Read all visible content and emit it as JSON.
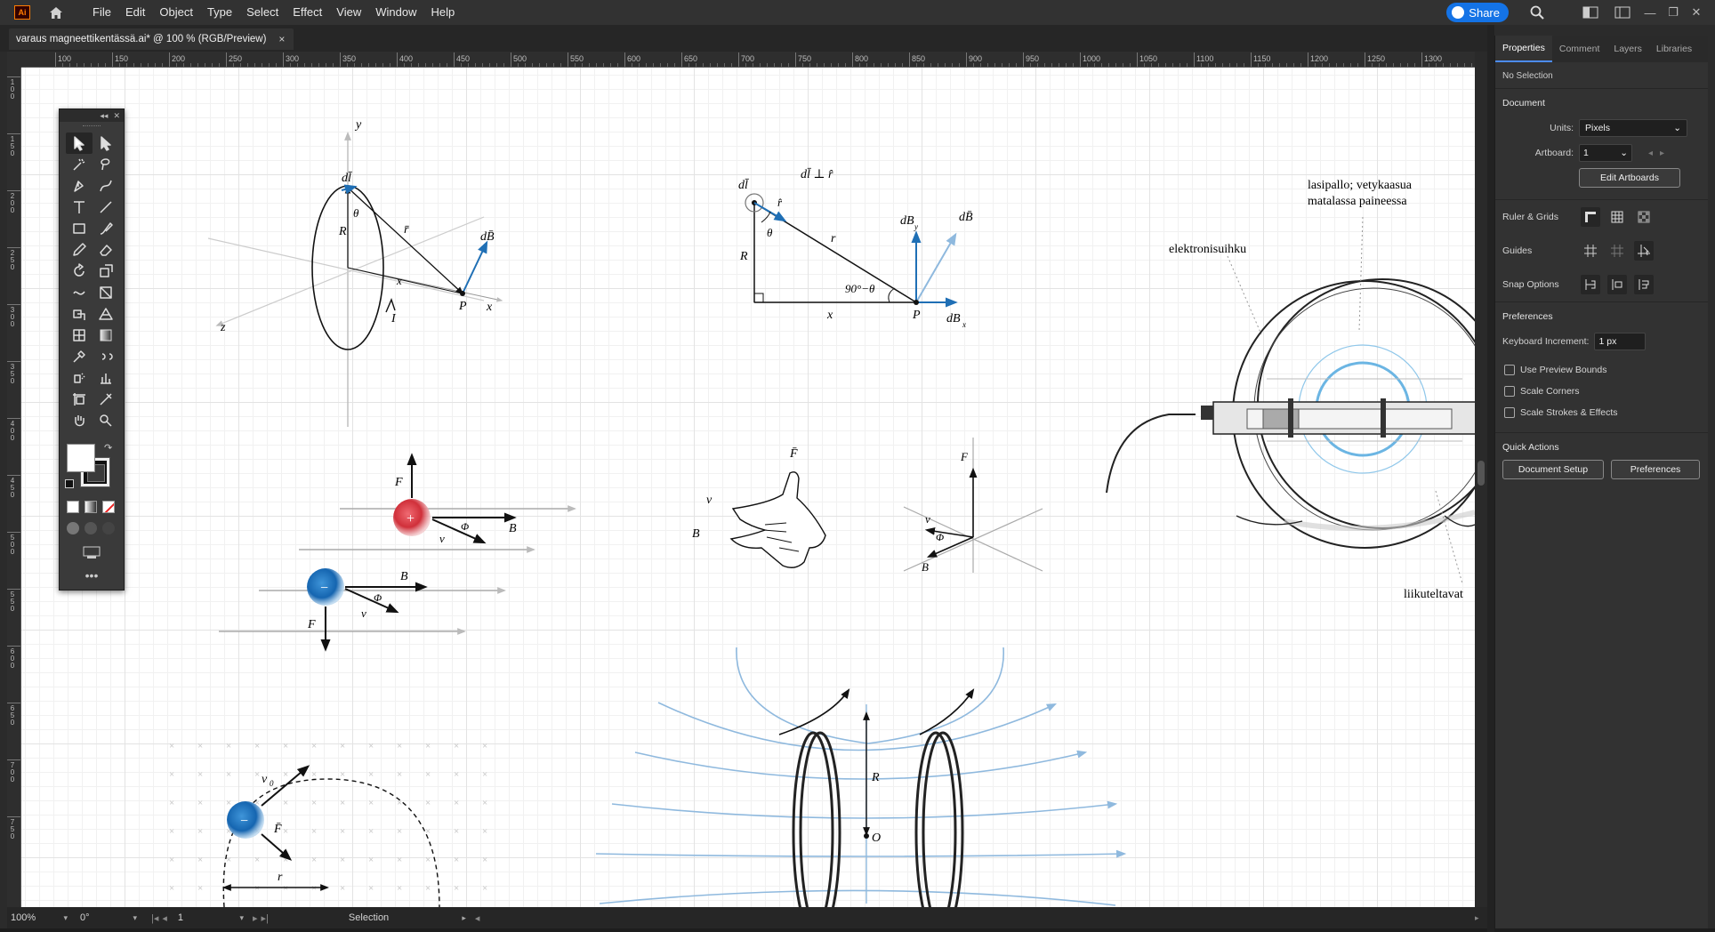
{
  "app": {
    "logo": "Ai",
    "menu": [
      "File",
      "Edit",
      "Object",
      "Type",
      "Select",
      "Effect",
      "View",
      "Window",
      "Help"
    ],
    "share_label": "Share"
  },
  "document": {
    "tab_title": "varaus magneettikentässä.ai* @ 100 % (RGB/Preview)",
    "tab_close": "×"
  },
  "ruler": {
    "top": [
      "100",
      "150",
      "200",
      "250",
      "300",
      "350",
      "400",
      "450",
      "500",
      "550",
      "600",
      "650",
      "700",
      "750",
      "800",
      "850",
      "900",
      "950",
      "1000",
      "1050",
      "1100",
      "1150",
      "1200",
      "1250",
      "1300"
    ],
    "left": [
      "100",
      "150",
      "200",
      "250",
      "300",
      "350",
      "400",
      "450",
      "500",
      "550",
      "600",
      "650",
      "700",
      "750"
    ]
  },
  "canvas_text": {
    "fig1": {
      "y": "y",
      "dl": "dl̄",
      "theta": "θ",
      "R": "R",
      "r": "r̄",
      "dB": "dB̄",
      "x_dist": "x",
      "P": "P",
      "x_axis": "x",
      "z_axis": "z",
      "I": "I"
    },
    "fig2": {
      "dl": "dl̄",
      "perp": "dl̄ ⊥ r̂",
      "rhat": "r̂",
      "theta": "θ",
      "r": "r",
      "R": "R",
      "angle": "90°−θ",
      "x": "x",
      "P": "P",
      "dBy": "dB",
      "dBy_sub": "y",
      "dB": "dB̄",
      "dBx": "dB",
      "dBx_sub": "x"
    },
    "fig3": {
      "glass": "lasipallo; vetykaasua",
      "glass2": "matalassa paineessa",
      "gun": "elektronisuihku",
      "coils": "liikuteltavat"
    },
    "fig4": {
      "F_top": "F",
      "plus": "+",
      "phi1": "Φ",
      "v1": "v",
      "B1": "B",
      "B2": "B",
      "phi2": "Φ",
      "minus": "−",
      "v2": "v",
      "F2": "F"
    },
    "fig5": {
      "F": "F̄",
      "v": "v",
      "B": "B",
      "F2": "F",
      "v2": "v",
      "phi": "Φ",
      "B2": "B"
    },
    "fig6": {
      "v0": "v",
      "v0_sub": "0",
      "minus": "−",
      "F": "F̄",
      "r": "r"
    },
    "fig7": {
      "R": "R",
      "O": "O"
    }
  },
  "statusbar": {
    "zoom": "100%",
    "rotate": "0°",
    "artboard": "1",
    "tool": "Selection"
  },
  "panel": {
    "tabs": [
      "Properties",
      "Comment",
      "Layers",
      "Libraries"
    ],
    "selection": "No Selection",
    "document_title": "Document",
    "units_label": "Units:",
    "units_value": "Pixels",
    "artboard_label": "Artboard:",
    "artboard_value": "1",
    "edit_artboards": "Edit Artboards",
    "rulers_grids": "Ruler & Grids",
    "guides": "Guides",
    "snap": "Snap Options",
    "preferences_title": "Preferences",
    "keyboard_inc_label": "Keyboard Increment:",
    "keyboard_inc_value": "1 px",
    "chk_preview": "Use Preview Bounds",
    "chk_corners": "Scale Corners",
    "chk_strokes": "Scale Strokes & Effects",
    "quick_actions": "Quick Actions",
    "doc_setup": "Document Setup",
    "prefs_btn": "Preferences"
  },
  "colors": {
    "accent": "#1473e6",
    "figure_blue": "#1f6fb5",
    "light_blue": "#8fb9de",
    "charge_red": "#d0303a"
  }
}
